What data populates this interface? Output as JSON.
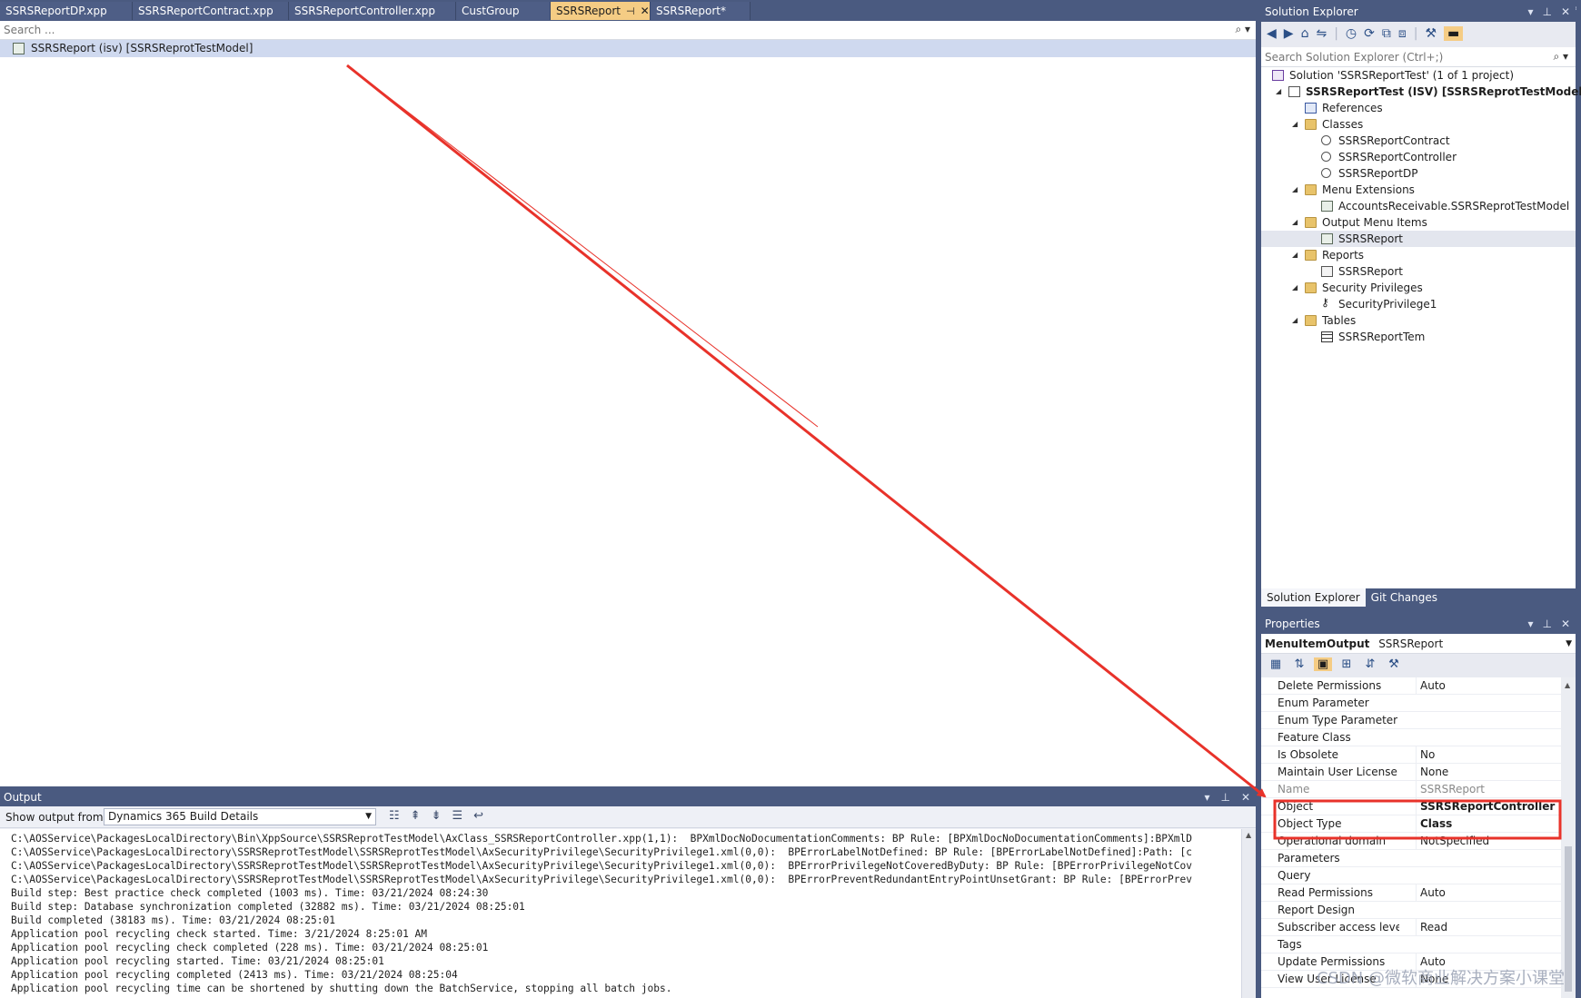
{
  "document_tabs": [
    {
      "label": "SSRSReportDP.xpp",
      "active": false
    },
    {
      "label": "SSRSReportContract.xpp",
      "active": false
    },
    {
      "label": "SSRSReportController.xpp",
      "active": false
    },
    {
      "label": "CustGroup",
      "active": false
    },
    {
      "label": "SSRSReport",
      "active": true
    },
    {
      "label": "SSRSReport*",
      "active": false
    }
  ],
  "editor": {
    "search_placeholder": "Search ...",
    "root_item": "SSRSReport (isv) [SSRSReprotTestModel]"
  },
  "output": {
    "title": "Output",
    "show_from_label": "Show output from:",
    "source": "Dynamics 365 Build Details",
    "lines": [
      "C:\\AOSService\\PackagesLocalDirectory\\Bin\\XppSource\\SSRSReprotTestModel\\AxClass_SSRSReportController.xpp(1,1):  BPXmlDocNoDocumentationComments: BP Rule: [BPXmlDocNoDocumentationComments]:BPXmlD",
      "C:\\AOSService\\PackagesLocalDirectory\\SSRSReprotTestModel\\SSRSReprotTestModel\\AxSecurityPrivilege\\SecurityPrivilege1.xml(0,0):  BPErrorLabelNotDefined: BP Rule: [BPErrorLabelNotDefined]:Path: [c",
      "C:\\AOSService\\PackagesLocalDirectory\\SSRSReprotTestModel\\SSRSReprotTestModel\\AxSecurityPrivilege\\SecurityPrivilege1.xml(0,0):  BPErrorPrivilegeNotCoveredByDuty: BP Rule: [BPErrorPrivilegeNotCov",
      "C:\\AOSService\\PackagesLocalDirectory\\SSRSReprotTestModel\\SSRSReprotTestModel\\AxSecurityPrivilege\\SecurityPrivilege1.xml(0,0):  BPErrorPreventRedundantEntryPointUnsetGrant: BP Rule: [BPErrorPrev",
      "Build step: Best practice check completed (1003 ms). Time: 03/21/2024 08:24:30",
      "Build step: Database synchronization completed (32882 ms). Time: 03/21/2024 08:25:01",
      "Build completed (38183 ms). Time: 03/21/2024 08:25:01",
      "Application pool recycling check started. Time: 3/21/2024 8:25:01 AM",
      "Application pool recycling check completed (228 ms). Time: 03/21/2024 08:25:01",
      "Application pool recycling started. Time: 03/21/2024 08:25:01",
      "Application pool recycling completed (2413 ms). Time: 03/21/2024 08:25:04",
      "Application pool recycling time can be shortened by shutting down the BatchService, stopping all batch jobs."
    ]
  },
  "solution_explorer": {
    "title": "Solution Explorer",
    "search_placeholder": "Search Solution Explorer (Ctrl+;)",
    "nodes": [
      {
        "label": "Solution 'SSRSReportTest' (1 of 1 project)",
        "level": 0,
        "icon": "solution-icon",
        "bold": false
      },
      {
        "label": "SSRSReportTest (ISV) [SSRSReprotTestModel]",
        "level": 1,
        "icon": "project-icon",
        "bold": true,
        "expand": "◢"
      },
      {
        "label": "References",
        "level": 2,
        "icon": "references-icon",
        "bold": false
      },
      {
        "label": "Classes",
        "level": 2,
        "icon": "folder-icon",
        "bold": false,
        "expand": "◢"
      },
      {
        "label": "SSRSReportContract",
        "level": 3,
        "icon": "class-icon",
        "bold": false
      },
      {
        "label": "SSRSReportController",
        "level": 3,
        "icon": "class-icon",
        "bold": false
      },
      {
        "label": "SSRSReportDP",
        "level": 3,
        "icon": "class-icon",
        "bold": false
      },
      {
        "label": "Menu Extensions",
        "level": 2,
        "icon": "folder-icon",
        "bold": false,
        "expand": "◢"
      },
      {
        "label": "AccountsReceivable.SSRSReprotTestModel",
        "level": 3,
        "icon": "menu-extension-icon",
        "bold": false
      },
      {
        "label": "Output Menu Items",
        "level": 2,
        "icon": "folder-icon",
        "bold": false,
        "expand": "◢"
      },
      {
        "label": "SSRSReport",
        "level": 3,
        "icon": "menu-item-icon",
        "bold": false,
        "selected": true
      },
      {
        "label": "Reports",
        "level": 2,
        "icon": "folder-icon",
        "bold": false,
        "expand": "◢"
      },
      {
        "label": "SSRSReport",
        "level": 3,
        "icon": "report-icon",
        "bold": false
      },
      {
        "label": "Security Privileges",
        "level": 2,
        "icon": "folder-icon",
        "bold": false,
        "expand": "◢"
      },
      {
        "label": "SecurityPrivilege1",
        "level": 3,
        "icon": "key-icon",
        "bold": false
      },
      {
        "label": "Tables",
        "level": 2,
        "icon": "folder-icon",
        "bold": false,
        "expand": "◢"
      },
      {
        "label": "SSRSReportTem",
        "level": 3,
        "icon": "table-icon",
        "bold": false
      }
    ],
    "tabs": [
      {
        "label": "Solution Explorer",
        "active": true
      },
      {
        "label": "Git Changes",
        "active": false
      }
    ]
  },
  "properties": {
    "title": "Properties",
    "object_type": "MenuItemOutput",
    "object_name": "SSRSReport",
    "rows": [
      {
        "name": "Delete Permissions",
        "value": "Auto"
      },
      {
        "name": "Enum Parameter",
        "value": ""
      },
      {
        "name": "Enum Type Parameter",
        "value": ""
      },
      {
        "name": "Feature Class",
        "value": ""
      },
      {
        "name": "Is Obsolete",
        "value": "No"
      },
      {
        "name": "Maintain User License",
        "value": "None"
      },
      {
        "name": "Name",
        "value": "SSRSReport",
        "dim": true
      },
      {
        "name": "Object",
        "value": "SSRSReportController",
        "bold": true,
        "highlight": true
      },
      {
        "name": "Object Type",
        "value": "Class",
        "bold": true,
        "highlight": true
      },
      {
        "name": "Operational domain",
        "value": "NotSpecified"
      },
      {
        "name": "Parameters",
        "value": ""
      },
      {
        "name": "Query",
        "value": ""
      },
      {
        "name": "Read Permissions",
        "value": "Auto"
      },
      {
        "name": "Report Design",
        "value": ""
      },
      {
        "name": "Subscriber access level",
        "value": "Read"
      },
      {
        "name": "Tags",
        "value": ""
      },
      {
        "name": "Update Permissions",
        "value": "Auto"
      },
      {
        "name": "View User License",
        "value": "None"
      }
    ]
  },
  "annotation": {
    "color": "#e8322a"
  },
  "watermark": "CSDN @微软商业解决方案小课堂"
}
